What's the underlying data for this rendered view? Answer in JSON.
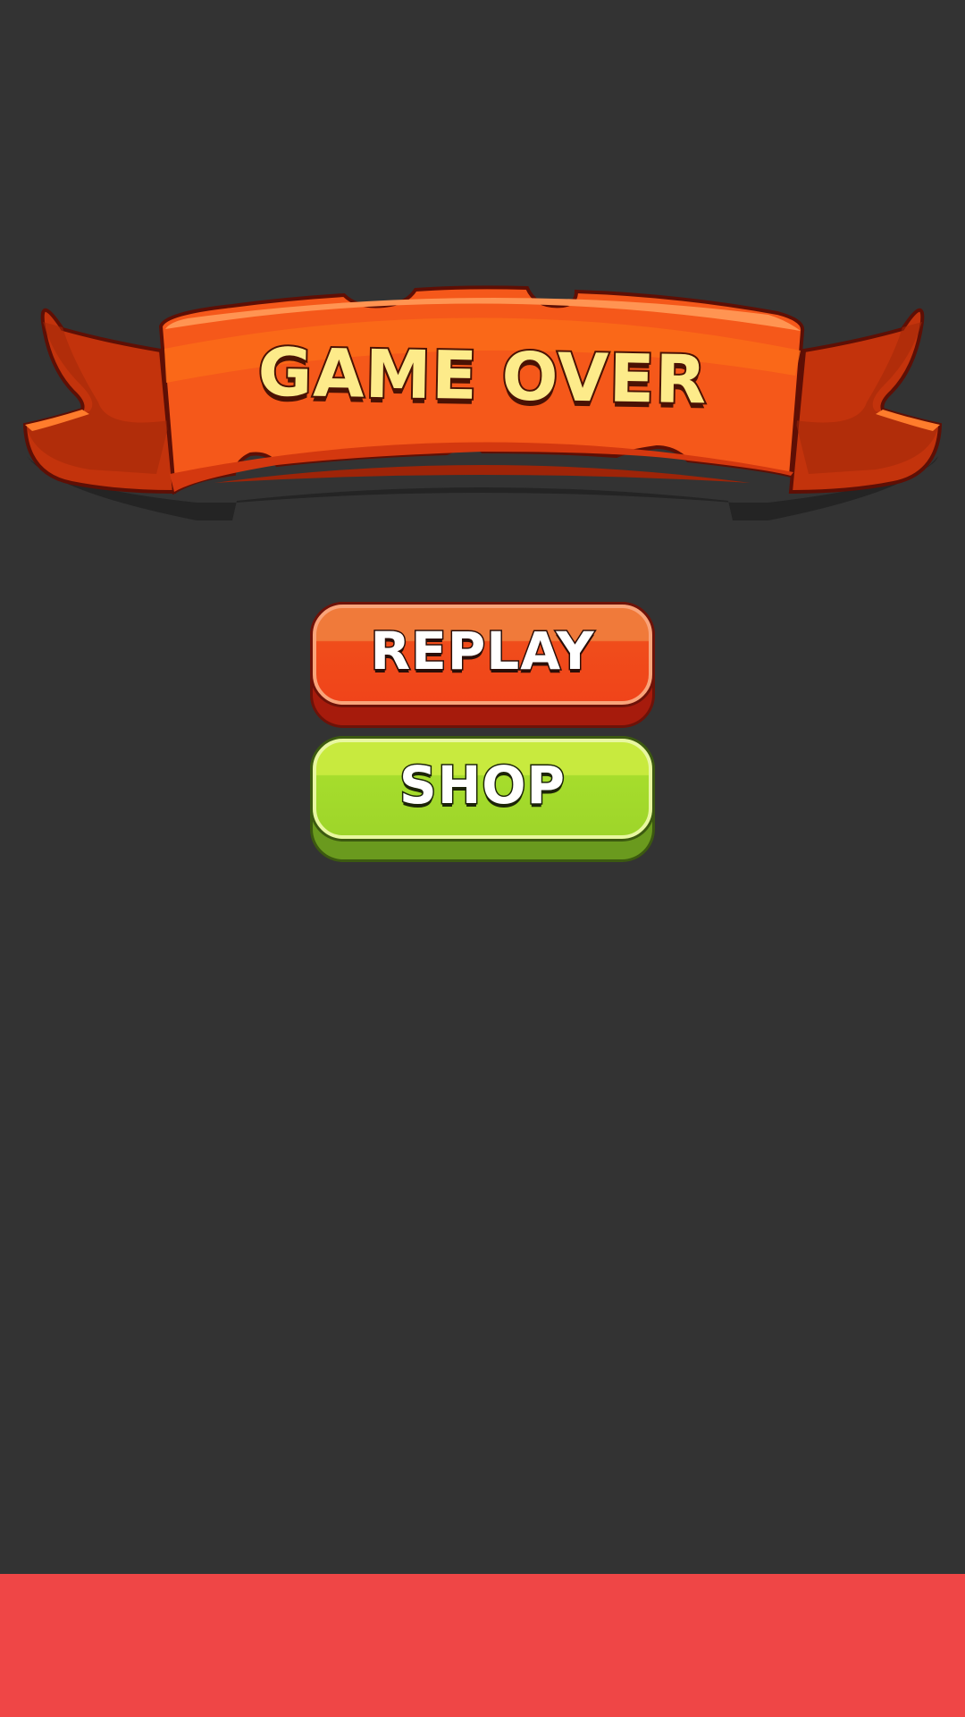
{
  "banner": {
    "title": "GAME OVER"
  },
  "buttons": {
    "replay_label": "REPLAY",
    "shop_label": "SHOP"
  },
  "colors": {
    "background": "#333333",
    "banner_orange": "#f5581a",
    "replay_red": "#f04d1b",
    "shop_green": "#a6dd2c",
    "footer_red": "#ef4646"
  }
}
